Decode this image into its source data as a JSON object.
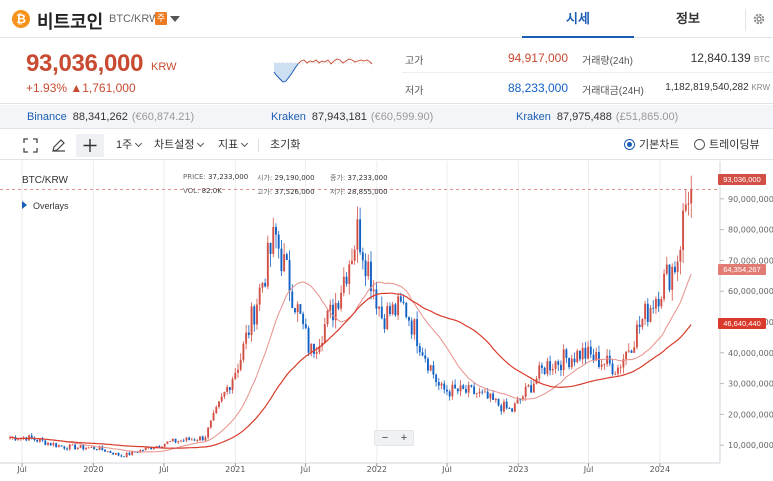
{
  "header": {
    "coin_symbol_glyph": "₿",
    "coin_name": "비트코인",
    "pair": "BTC/KRW",
    "caution_badge": "주",
    "tabs": [
      "시세",
      "정보"
    ]
  },
  "summary": {
    "price": "93,036,000",
    "price_unit": "KRW",
    "change_text": "+1.93%  ▲1,761,000",
    "high_label": "고가",
    "high_value": "94,917,000",
    "low_label": "저가",
    "low_value": "88,233,000",
    "volume_label": "거래량(24h)",
    "volume_value": "12,840.139",
    "volume_unit": "BTC",
    "amount_label": "거래대금(24H)",
    "amount_value": "1,182,819,540,282",
    "amount_unit": "KRW"
  },
  "exchanges": [
    {
      "name": "Binance",
      "price": "88,341,262",
      "foreign": "(€60,874.21)"
    },
    {
      "name": "Kraken",
      "price": "87,943,181",
      "foreign": "(€60,599.90)"
    },
    {
      "name": "Kraken",
      "price": "87,975,488",
      "foreign": "(£51,865.00)"
    }
  ],
  "toolbar": {
    "interval": "1주",
    "chart_settings": "차트설정",
    "indicators": "지표",
    "reset": "초기화",
    "basic_chart": "기본차트",
    "tradingview": "트레이딩뷰"
  },
  "chart": {
    "symbol": "BTC/KRW",
    "overlays_label": "Overlays",
    "legend_price_label": "PRICE:",
    "legend_price": "37,233,000",
    "legend_open_label": "시가:",
    "legend_open": "29,190,000",
    "legend_close_label": "종가:",
    "legend_close": "37,233,000",
    "legend_vol_label": "VOL:",
    "legend_vol": "82.0K",
    "legend_high_label": "고가:",
    "legend_high": "37,526,000",
    "legend_low_label": "저가:",
    "legend_low": "28,855,000",
    "zoom_out": "−",
    "zoom_in": "+",
    "price_tags": [
      "93,036,000",
      "64,354,267",
      "46,640,440"
    ],
    "colors": {
      "up": "#d24f45",
      "down": "#1261c4",
      "ma_short": "#e8908a",
      "ma_long": "#d93a2b",
      "current_line": "#d24f45"
    }
  },
  "chart_data": {
    "type": "candlestick",
    "x_ticks": [
      "Jul",
      "2020",
      "Jul",
      "2021",
      "Jul",
      "2022",
      "Jul",
      "2023",
      "Jul",
      "2024"
    ],
    "y_ticks": [
      "10,000,000",
      "20,000,000",
      "30,000,000",
      "40,000,000",
      "50,000,000",
      "60,000,000",
      "70,000,000",
      "80,000,000",
      "90,000,000"
    ],
    "ylim": [
      0,
      100000000
    ],
    "x_range": [
      "2019-06",
      "2024-03"
    ],
    "close_approx": [
      [
        "2019-07",
        12500000
      ],
      [
        "2019-10",
        9500000
      ],
      [
        "2020-01",
        9000000
      ],
      [
        "2020-03",
        6500000
      ],
      [
        "2020-07",
        11000000
      ],
      [
        "2020-10",
        12500000
      ],
      [
        "2021-01",
        38000000
      ],
      [
        "2021-04",
        78000000
      ],
      [
        "2021-07",
        40000000
      ],
      [
        "2021-09",
        55000000
      ],
      [
        "2021-11",
        80000000
      ],
      [
        "2022-01",
        52000000
      ],
      [
        "2022-03",
        55000000
      ],
      [
        "2022-06",
        28000000
      ],
      [
        "2022-09",
        27000000
      ],
      [
        "2022-12",
        21000000
      ],
      [
        "2023-03",
        36000000
      ],
      [
        "2023-06",
        40000000
      ],
      [
        "2023-09",
        35000000
      ],
      [
        "2023-12",
        57000000
      ],
      [
        "2024-02",
        70000000
      ],
      [
        "2024-03",
        93036000
      ]
    ]
  }
}
